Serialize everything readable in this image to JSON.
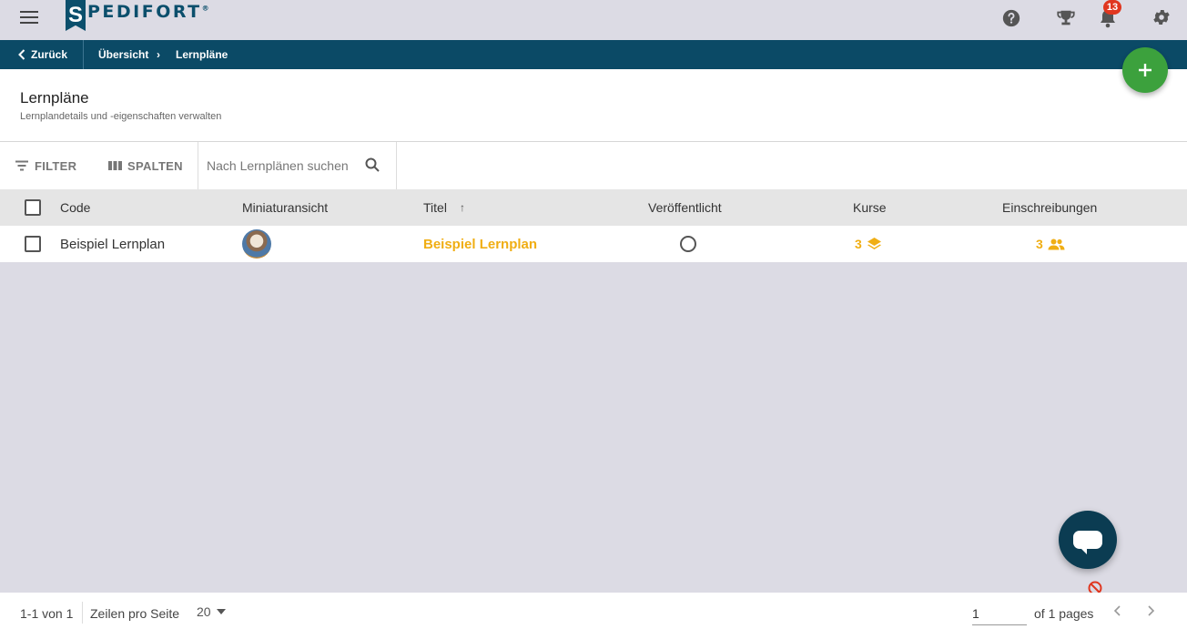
{
  "brand": {
    "name": "PEDIFORT",
    "mark": "S",
    "reg": "®"
  },
  "notifications": {
    "count": "13"
  },
  "nav": {
    "back_label": "Zurück",
    "crumb_overview": "Übersicht",
    "crumb_separator": "›",
    "crumb_current": "Lernpläne"
  },
  "page": {
    "title": "Lernpläne",
    "subtitle": "Lernplandetails und -eigenschaften verwalten"
  },
  "toolbar": {
    "filter_label": "FILTER",
    "columns_label": "SPALTEN",
    "search_placeholder": "Nach Lernplänen suchen"
  },
  "table": {
    "columns": [
      "Code",
      "Miniaturansicht",
      "Titel",
      "Veröffentlicht",
      "Kurse",
      "Einschreibungen"
    ],
    "sort_indicator": "↑",
    "rows": [
      {
        "code": "Beispiel Lernplan",
        "title": "Beispiel Lernplan",
        "published": false,
        "courses": "3",
        "enrollments": "3"
      }
    ]
  },
  "footer": {
    "range": "1-1 von 1",
    "rows_label": "Zeilen pro Seite",
    "rows_value": "20",
    "page_value": "1",
    "pages_text": "of 1 pages"
  },
  "colors": {
    "brand_dark": "#0b4a66",
    "accent": "#f0ae14",
    "fab_green": "#3ca13d",
    "badge_red": "#e0361f"
  },
  "icons": [
    "menu-icon",
    "help-icon",
    "trophy-icon",
    "bell-icon",
    "settings-icon",
    "chevron-left-icon",
    "plus-icon",
    "filter-icon",
    "columns-icon",
    "search-icon",
    "arrow-up-icon",
    "layers-icon",
    "people-icon",
    "chat-icon",
    "block-icon",
    "dropdown-arrow-icon",
    "chevron-right-icon"
  ]
}
